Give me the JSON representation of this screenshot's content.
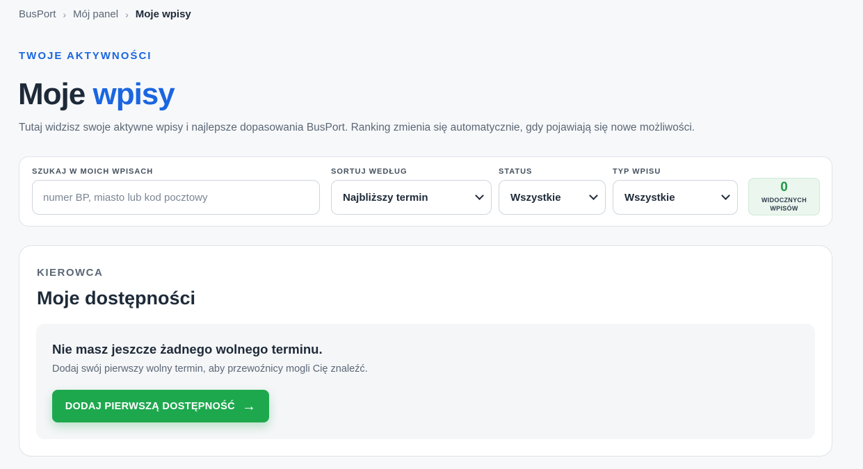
{
  "breadcrumb": {
    "items": [
      "BusPort",
      "Mój panel",
      "Moje wpisy"
    ],
    "separator": "›"
  },
  "header": {
    "eyebrow": "TWOJE AKTYWNOŚCI",
    "title_plain": "Moje",
    "title_accent": "wpisy",
    "subtitle": "Tutaj widzisz swoje aktywne wpisy i najlepsze dopasowania BusPort. Ranking zmienia się automatycznie, gdy pojawiają się nowe możliwości."
  },
  "filters": {
    "search": {
      "label": "SZUKAJ W MOICH WPISACH",
      "placeholder": "numer BP, miasto lub kod pocztowy",
      "value": ""
    },
    "sort": {
      "label": "SORTUJ WEDŁUG",
      "value": "Najbliższy termin"
    },
    "status": {
      "label": "STATUS",
      "value": "Wszystkie"
    },
    "type": {
      "label": "TYP WPISU",
      "value": "Wszystkie"
    },
    "visible_count": {
      "value": "0",
      "label": "WIDOCZNYCH WPISÓW"
    }
  },
  "section": {
    "eyebrow": "KIEROWCA",
    "title": "Moje dostępności",
    "empty_title": "Nie masz jeszcze żadnego wolnego terminu.",
    "empty_desc": "Dodaj swój pierwszy wolny termin, aby przewoźnicy mogli Cię znaleźć.",
    "cta_label": "DODAJ PIERWSZĄ DOSTĘPNOŚĆ",
    "cta_arrow": "→"
  },
  "colors": {
    "accent": "#1a66e0",
    "success": "#1ea84e",
    "count_text": "#1f9a4a"
  },
  "icons": [
    "chevron-down-icon",
    "arrow-right-icon"
  ]
}
